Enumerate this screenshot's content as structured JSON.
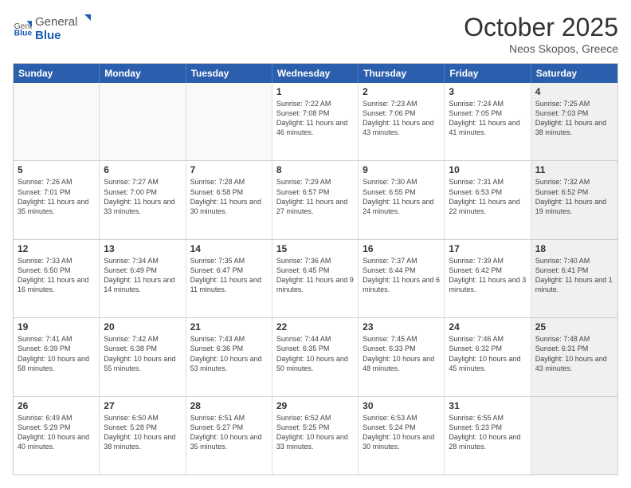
{
  "header": {
    "logo": {
      "general": "General",
      "blue": "Blue"
    },
    "month": "October 2025",
    "location": "Neos Skopos, Greece"
  },
  "weekdays": [
    "Sunday",
    "Monday",
    "Tuesday",
    "Wednesday",
    "Thursday",
    "Friday",
    "Saturday"
  ],
  "rows": [
    [
      {
        "day": "",
        "sunrise": "",
        "sunset": "",
        "daylight": "",
        "empty": true
      },
      {
        "day": "",
        "sunrise": "",
        "sunset": "",
        "daylight": "",
        "empty": true
      },
      {
        "day": "",
        "sunrise": "",
        "sunset": "",
        "daylight": "",
        "empty": true
      },
      {
        "day": "1",
        "sunrise": "Sunrise: 7:22 AM",
        "sunset": "Sunset: 7:08 PM",
        "daylight": "Daylight: 11 hours and 46 minutes.",
        "empty": false
      },
      {
        "day": "2",
        "sunrise": "Sunrise: 7:23 AM",
        "sunset": "Sunset: 7:06 PM",
        "daylight": "Daylight: 11 hours and 43 minutes.",
        "empty": false
      },
      {
        "day": "3",
        "sunrise": "Sunrise: 7:24 AM",
        "sunset": "Sunset: 7:05 PM",
        "daylight": "Daylight: 11 hours and 41 minutes.",
        "empty": false
      },
      {
        "day": "4",
        "sunrise": "Sunrise: 7:25 AM",
        "sunset": "Sunset: 7:03 PM",
        "daylight": "Daylight: 11 hours and 38 minutes.",
        "empty": false,
        "shaded": true
      }
    ],
    [
      {
        "day": "5",
        "sunrise": "Sunrise: 7:26 AM",
        "sunset": "Sunset: 7:01 PM",
        "daylight": "Daylight: 11 hours and 35 minutes.",
        "empty": false
      },
      {
        "day": "6",
        "sunrise": "Sunrise: 7:27 AM",
        "sunset": "Sunset: 7:00 PM",
        "daylight": "Daylight: 11 hours and 33 minutes.",
        "empty": false
      },
      {
        "day": "7",
        "sunrise": "Sunrise: 7:28 AM",
        "sunset": "Sunset: 6:58 PM",
        "daylight": "Daylight: 11 hours and 30 minutes.",
        "empty": false
      },
      {
        "day": "8",
        "sunrise": "Sunrise: 7:29 AM",
        "sunset": "Sunset: 6:57 PM",
        "daylight": "Daylight: 11 hours and 27 minutes.",
        "empty": false
      },
      {
        "day": "9",
        "sunrise": "Sunrise: 7:30 AM",
        "sunset": "Sunset: 6:55 PM",
        "daylight": "Daylight: 11 hours and 24 minutes.",
        "empty": false
      },
      {
        "day": "10",
        "sunrise": "Sunrise: 7:31 AM",
        "sunset": "Sunset: 6:53 PM",
        "daylight": "Daylight: 11 hours and 22 minutes.",
        "empty": false
      },
      {
        "day": "11",
        "sunrise": "Sunrise: 7:32 AM",
        "sunset": "Sunset: 6:52 PM",
        "daylight": "Daylight: 11 hours and 19 minutes.",
        "empty": false,
        "shaded": true
      }
    ],
    [
      {
        "day": "12",
        "sunrise": "Sunrise: 7:33 AM",
        "sunset": "Sunset: 6:50 PM",
        "daylight": "Daylight: 11 hours and 16 minutes.",
        "empty": false
      },
      {
        "day": "13",
        "sunrise": "Sunrise: 7:34 AM",
        "sunset": "Sunset: 6:49 PM",
        "daylight": "Daylight: 11 hours and 14 minutes.",
        "empty": false
      },
      {
        "day": "14",
        "sunrise": "Sunrise: 7:35 AM",
        "sunset": "Sunset: 6:47 PM",
        "daylight": "Daylight: 11 hours and 11 minutes.",
        "empty": false
      },
      {
        "day": "15",
        "sunrise": "Sunrise: 7:36 AM",
        "sunset": "Sunset: 6:45 PM",
        "daylight": "Daylight: 11 hours and 9 minutes.",
        "empty": false
      },
      {
        "day": "16",
        "sunrise": "Sunrise: 7:37 AM",
        "sunset": "Sunset: 6:44 PM",
        "daylight": "Daylight: 11 hours and 6 minutes.",
        "empty": false
      },
      {
        "day": "17",
        "sunrise": "Sunrise: 7:39 AM",
        "sunset": "Sunset: 6:42 PM",
        "daylight": "Daylight: 11 hours and 3 minutes.",
        "empty": false
      },
      {
        "day": "18",
        "sunrise": "Sunrise: 7:40 AM",
        "sunset": "Sunset: 6:41 PM",
        "daylight": "Daylight: 11 hours and 1 minute.",
        "empty": false,
        "shaded": true
      }
    ],
    [
      {
        "day": "19",
        "sunrise": "Sunrise: 7:41 AM",
        "sunset": "Sunset: 6:39 PM",
        "daylight": "Daylight: 10 hours and 58 minutes.",
        "empty": false
      },
      {
        "day": "20",
        "sunrise": "Sunrise: 7:42 AM",
        "sunset": "Sunset: 6:38 PM",
        "daylight": "Daylight: 10 hours and 55 minutes.",
        "empty": false
      },
      {
        "day": "21",
        "sunrise": "Sunrise: 7:43 AM",
        "sunset": "Sunset: 6:36 PM",
        "daylight": "Daylight: 10 hours and 53 minutes.",
        "empty": false
      },
      {
        "day": "22",
        "sunrise": "Sunrise: 7:44 AM",
        "sunset": "Sunset: 6:35 PM",
        "daylight": "Daylight: 10 hours and 50 minutes.",
        "empty": false
      },
      {
        "day": "23",
        "sunrise": "Sunrise: 7:45 AM",
        "sunset": "Sunset: 6:33 PM",
        "daylight": "Daylight: 10 hours and 48 minutes.",
        "empty": false
      },
      {
        "day": "24",
        "sunrise": "Sunrise: 7:46 AM",
        "sunset": "Sunset: 6:32 PM",
        "daylight": "Daylight: 10 hours and 45 minutes.",
        "empty": false
      },
      {
        "day": "25",
        "sunrise": "Sunrise: 7:48 AM",
        "sunset": "Sunset: 6:31 PM",
        "daylight": "Daylight: 10 hours and 43 minutes.",
        "empty": false,
        "shaded": true
      }
    ],
    [
      {
        "day": "26",
        "sunrise": "Sunrise: 6:49 AM",
        "sunset": "Sunset: 5:29 PM",
        "daylight": "Daylight: 10 hours and 40 minutes.",
        "empty": false
      },
      {
        "day": "27",
        "sunrise": "Sunrise: 6:50 AM",
        "sunset": "Sunset: 5:28 PM",
        "daylight": "Daylight: 10 hours and 38 minutes.",
        "empty": false
      },
      {
        "day": "28",
        "sunrise": "Sunrise: 6:51 AM",
        "sunset": "Sunset: 5:27 PM",
        "daylight": "Daylight: 10 hours and 35 minutes.",
        "empty": false
      },
      {
        "day": "29",
        "sunrise": "Sunrise: 6:52 AM",
        "sunset": "Sunset: 5:25 PM",
        "daylight": "Daylight: 10 hours and 33 minutes.",
        "empty": false
      },
      {
        "day": "30",
        "sunrise": "Sunrise: 6:53 AM",
        "sunset": "Sunset: 5:24 PM",
        "daylight": "Daylight: 10 hours and 30 minutes.",
        "empty": false
      },
      {
        "day": "31",
        "sunrise": "Sunrise: 6:55 AM",
        "sunset": "Sunset: 5:23 PM",
        "daylight": "Daylight: 10 hours and 28 minutes.",
        "empty": false
      },
      {
        "day": "",
        "sunrise": "",
        "sunset": "",
        "daylight": "",
        "empty": true,
        "shaded": true
      }
    ]
  ]
}
